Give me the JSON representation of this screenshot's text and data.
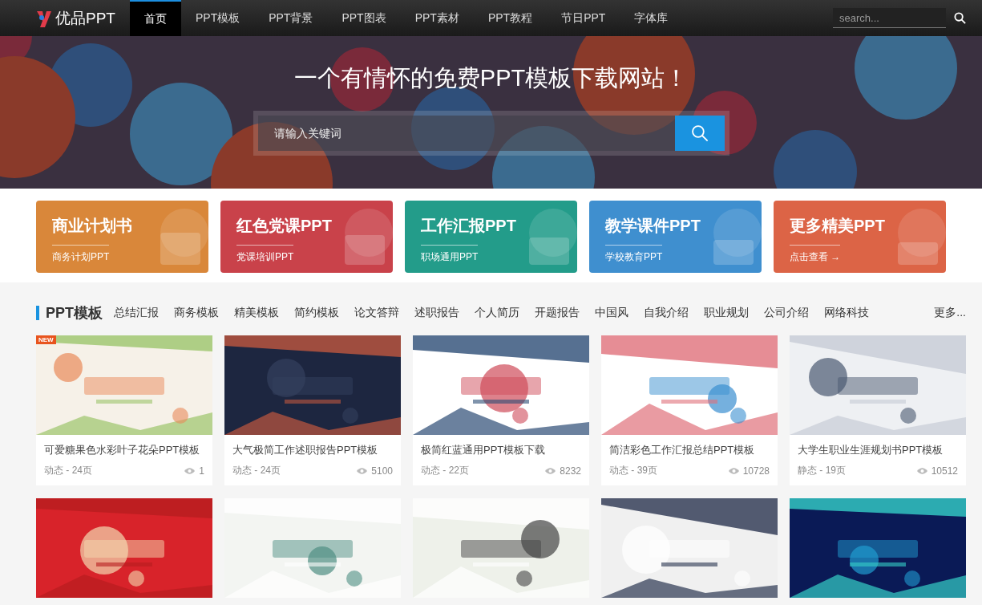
{
  "nav": {
    "logo": "优品PPT",
    "items": [
      {
        "label": "首页",
        "selected": true
      },
      {
        "label": "PPT模板",
        "selected": false
      },
      {
        "label": "PPT背景",
        "selected": false
      },
      {
        "label": "PPT图表",
        "selected": false
      },
      {
        "label": "PPT素材",
        "selected": false
      },
      {
        "label": "PPT教程",
        "selected": false
      },
      {
        "label": "节日PPT",
        "selected": false
      },
      {
        "label": "字体库",
        "selected": false
      }
    ],
    "search": {
      "placeholder": "search..."
    }
  },
  "hero": {
    "title": "一个有情怀的免费PPT模板下载网站！",
    "search": {
      "placeholder": "请输入关键词"
    }
  },
  "banners": [
    {
      "title": "商业计划书",
      "subtitle": "商务计划PPT",
      "color": "#d9873a"
    },
    {
      "title": "红色党课PPT",
      "subtitle": "党课培训PPT",
      "color": "#c9424a"
    },
    {
      "title": "工作汇报PPT",
      "subtitle": "职场通用PPT",
      "color": "#239c8a"
    },
    {
      "title": "教学课件PPT",
      "subtitle": "学校教育PPT",
      "color": "#3f8fcf"
    },
    {
      "title": "更多精美PPT",
      "subtitle": "点击查看 →",
      "color": "#dc6446"
    }
  ],
  "section": {
    "title": "PPT模板",
    "tags": [
      "总结汇报",
      "商务模板",
      "精美模板",
      "简约模板",
      "论文答辩",
      "述职报告",
      "个人简历",
      "开题报告",
      "中国风",
      "自我介绍",
      "职业规划",
      "公司介绍",
      "网络科技"
    ],
    "more": "更多..."
  },
  "templates": [
    {
      "badge": "NEW",
      "title": "可爱糖果色水彩叶子花朵PPT模板",
      "meta": "动态 - 24页",
      "views": "1"
    },
    {
      "title": "大气极简工作述职报告PPT模板",
      "meta": "动态 - 24页",
      "views": "5100"
    },
    {
      "title": "极简红蓝通用PPT模板下载",
      "meta": "动态 - 22页",
      "views": "8232"
    },
    {
      "title": "简洁彩色工作汇报总结PPT模板",
      "meta": "动态 - 39页",
      "views": "10728"
    },
    {
      "title": "大学生职业生涯规划书PPT模板",
      "meta": "静态 - 19页",
      "views": "10512"
    },
    {
      "kind": "picture"
    },
    {
      "kind": "picture"
    },
    {
      "kind": "picture"
    },
    {
      "kind": "picture"
    },
    {
      "kind": "picture"
    }
  ]
}
